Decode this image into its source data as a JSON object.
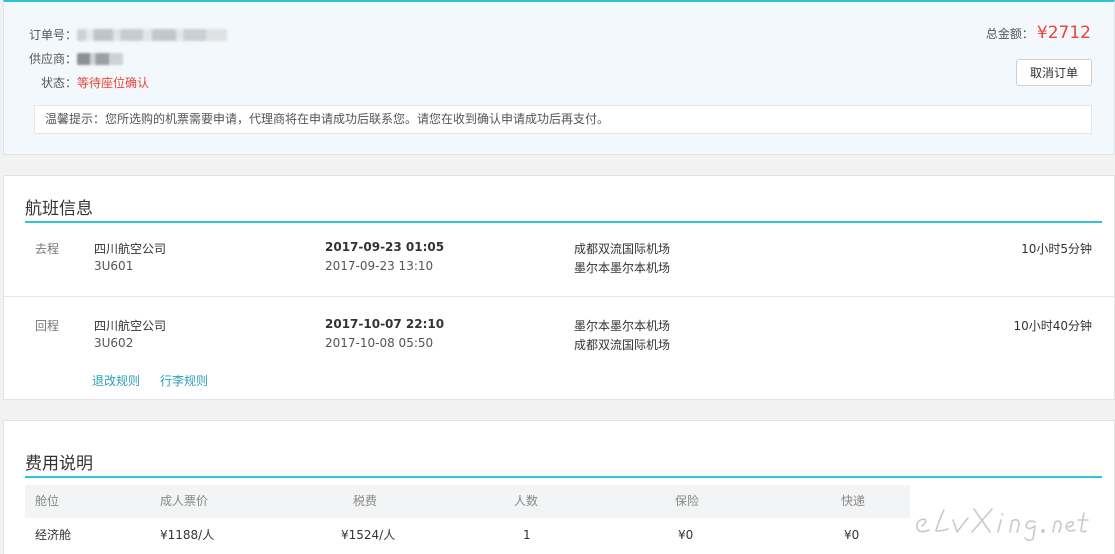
{
  "order": {
    "number_label": "订单号：",
    "supplier_label": "供应商：",
    "status_label": "状态：",
    "status_value": "等待座位确认",
    "total_label": "总金额：",
    "total_amount": "¥2712",
    "cancel_button": "取消订单",
    "tip": "温馨提示：您所选购的机票需要申请，代理商将在申请成功后联系您。请您在收到确认申请成功后再支付。"
  },
  "flights_section": {
    "title": "航班信息",
    "segments": [
      {
        "direction": "去程",
        "airline": "四川航空公司",
        "flight_no": "3U601",
        "dep_time": "2017-09-23 01:05",
        "arr_time": "2017-09-23 13:10",
        "dep_airport": "成都双流国际机场",
        "arr_airport": "墨尔本墨尔本机场",
        "duration": "10小时5分钟"
      },
      {
        "direction": "回程",
        "airline": "四川航空公司",
        "flight_no": "3U602",
        "dep_time": "2017-10-07 22:10",
        "arr_time": "2017-10-08 05:50",
        "dep_airport": "墨尔本墨尔本机场",
        "arr_airport": "成都双流国际机场",
        "duration": "10小时40分钟"
      }
    ],
    "links": [
      "退改规则",
      "行李规则"
    ]
  },
  "fees_section": {
    "title": "费用说明",
    "columns": [
      "舱位",
      "成人票价",
      "税费",
      "人数",
      "保险",
      "快递"
    ],
    "rows": [
      [
        "经济舱",
        "¥1188/人",
        "¥1524/人",
        "1",
        "¥0",
        "¥0"
      ]
    ]
  },
  "watermark": {
    "text": "eLvXing.net",
    "icon": "elvxing-logo-watermark"
  },
  "colors": {
    "accent": "#2cc4d9",
    "price": "#e8463a",
    "link": "#2a9fb9"
  }
}
